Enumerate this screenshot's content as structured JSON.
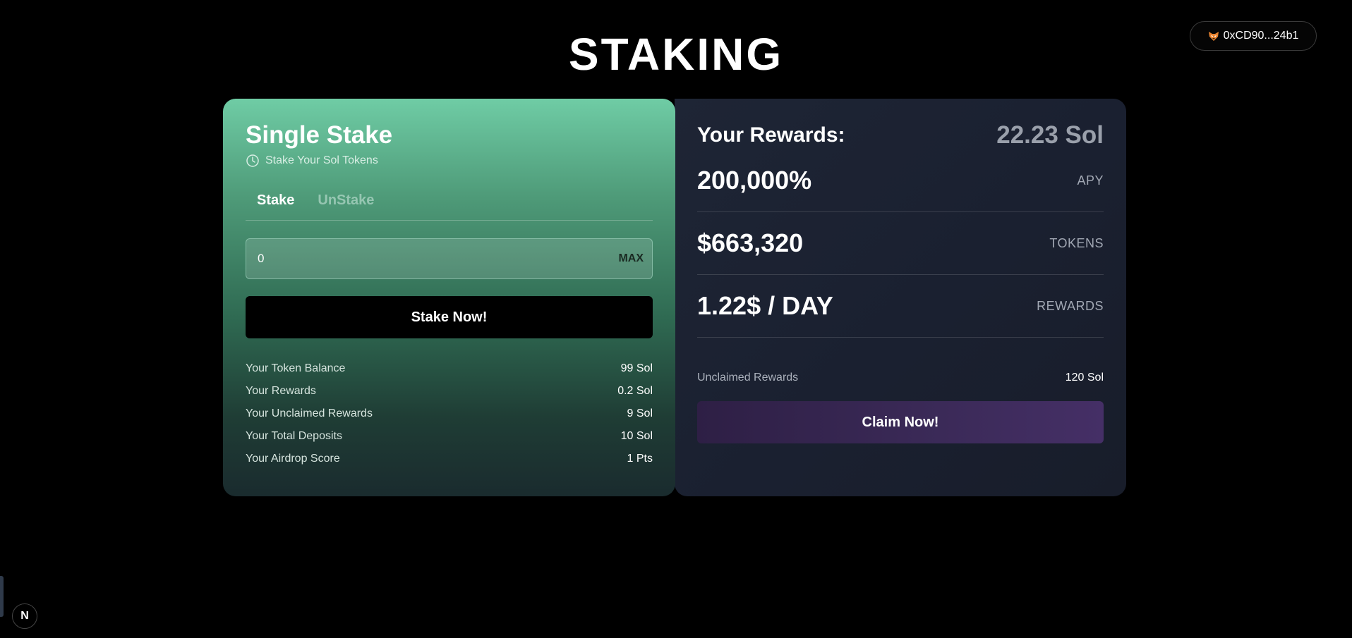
{
  "header": {
    "title": "STAKING",
    "wallet_address": "0xCD90...24b1",
    "wallet_icon": "fox-icon"
  },
  "stake_card": {
    "title": "Single Stake",
    "subtitle": "Stake Your Sol Tokens",
    "subtitle_icon": "clock-icon",
    "tabs": [
      {
        "label": "Stake",
        "active": true
      },
      {
        "label": "UnStake",
        "active": false
      }
    ],
    "amount_value": "0",
    "max_label": "MAX",
    "button_label": "Stake Now!",
    "stats": [
      {
        "label": "Your Token Balance",
        "value": "99 Sol"
      },
      {
        "label": "Your Rewards",
        "value": "0.2 Sol"
      },
      {
        "label": "Your Unclaimed Rewards",
        "value": "9 Sol"
      },
      {
        "label": "Your Total Deposits",
        "value": "10 Sol"
      },
      {
        "label": "Your Airdrop Score",
        "value": "1 Pts"
      }
    ]
  },
  "rewards_card": {
    "title": "Your Rewards:",
    "total": "22.23 Sol",
    "metrics": [
      {
        "value": "200,000%",
        "label": "APY"
      },
      {
        "value": "$663,320",
        "label": "TOKENS"
      },
      {
        "value": "1.22$ / DAY",
        "label": "REWARDS"
      }
    ],
    "unclaimed_label": "Unclaimed Rewards",
    "unclaimed_value": "120 Sol",
    "button_label": "Claim Now!"
  },
  "dev_badge": "N",
  "colors": {
    "background": "#000000",
    "stake_gradient_top": "#6fcca5",
    "stake_gradient_bottom": "#1a2b2e",
    "rewards_card_bg": "#1e2535",
    "claim_button": "#3b2a58"
  }
}
